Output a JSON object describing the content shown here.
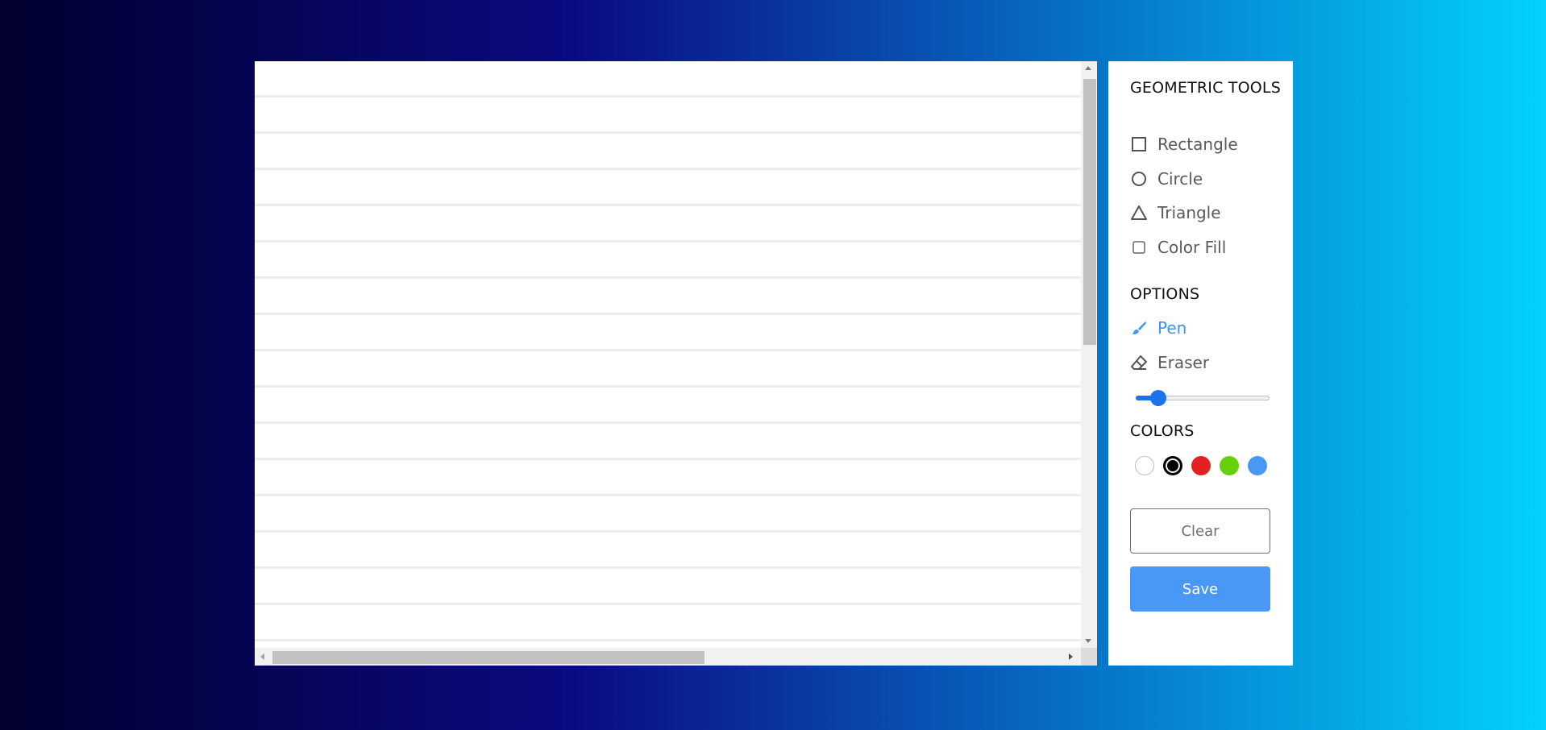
{
  "panel": {
    "geometric_title": "GEOMETRIC TOOLS",
    "shapes": [
      {
        "label": "Rectangle",
        "icon": "square-icon"
      },
      {
        "label": "Circle",
        "icon": "circle-icon"
      },
      {
        "label": "Triangle",
        "icon": "triangle-icon"
      }
    ],
    "color_fill_label": "Color Fill",
    "color_fill_checked": false,
    "options_title": "OPTIONS",
    "pen_label": "Pen",
    "eraser_label": "Eraser",
    "active_tool": "Pen",
    "brush_size_fraction": 0.17,
    "colors_title": "COLORS",
    "colors": [
      "#ffffff",
      "#000000",
      "#e32121",
      "#67d00a",
      "#4a98f5"
    ],
    "selected_color": "#000000",
    "clear_label": "Clear",
    "save_label": "Save"
  },
  "theme": {
    "accent": "#3a95f0",
    "save_button": "#4a98f5"
  }
}
